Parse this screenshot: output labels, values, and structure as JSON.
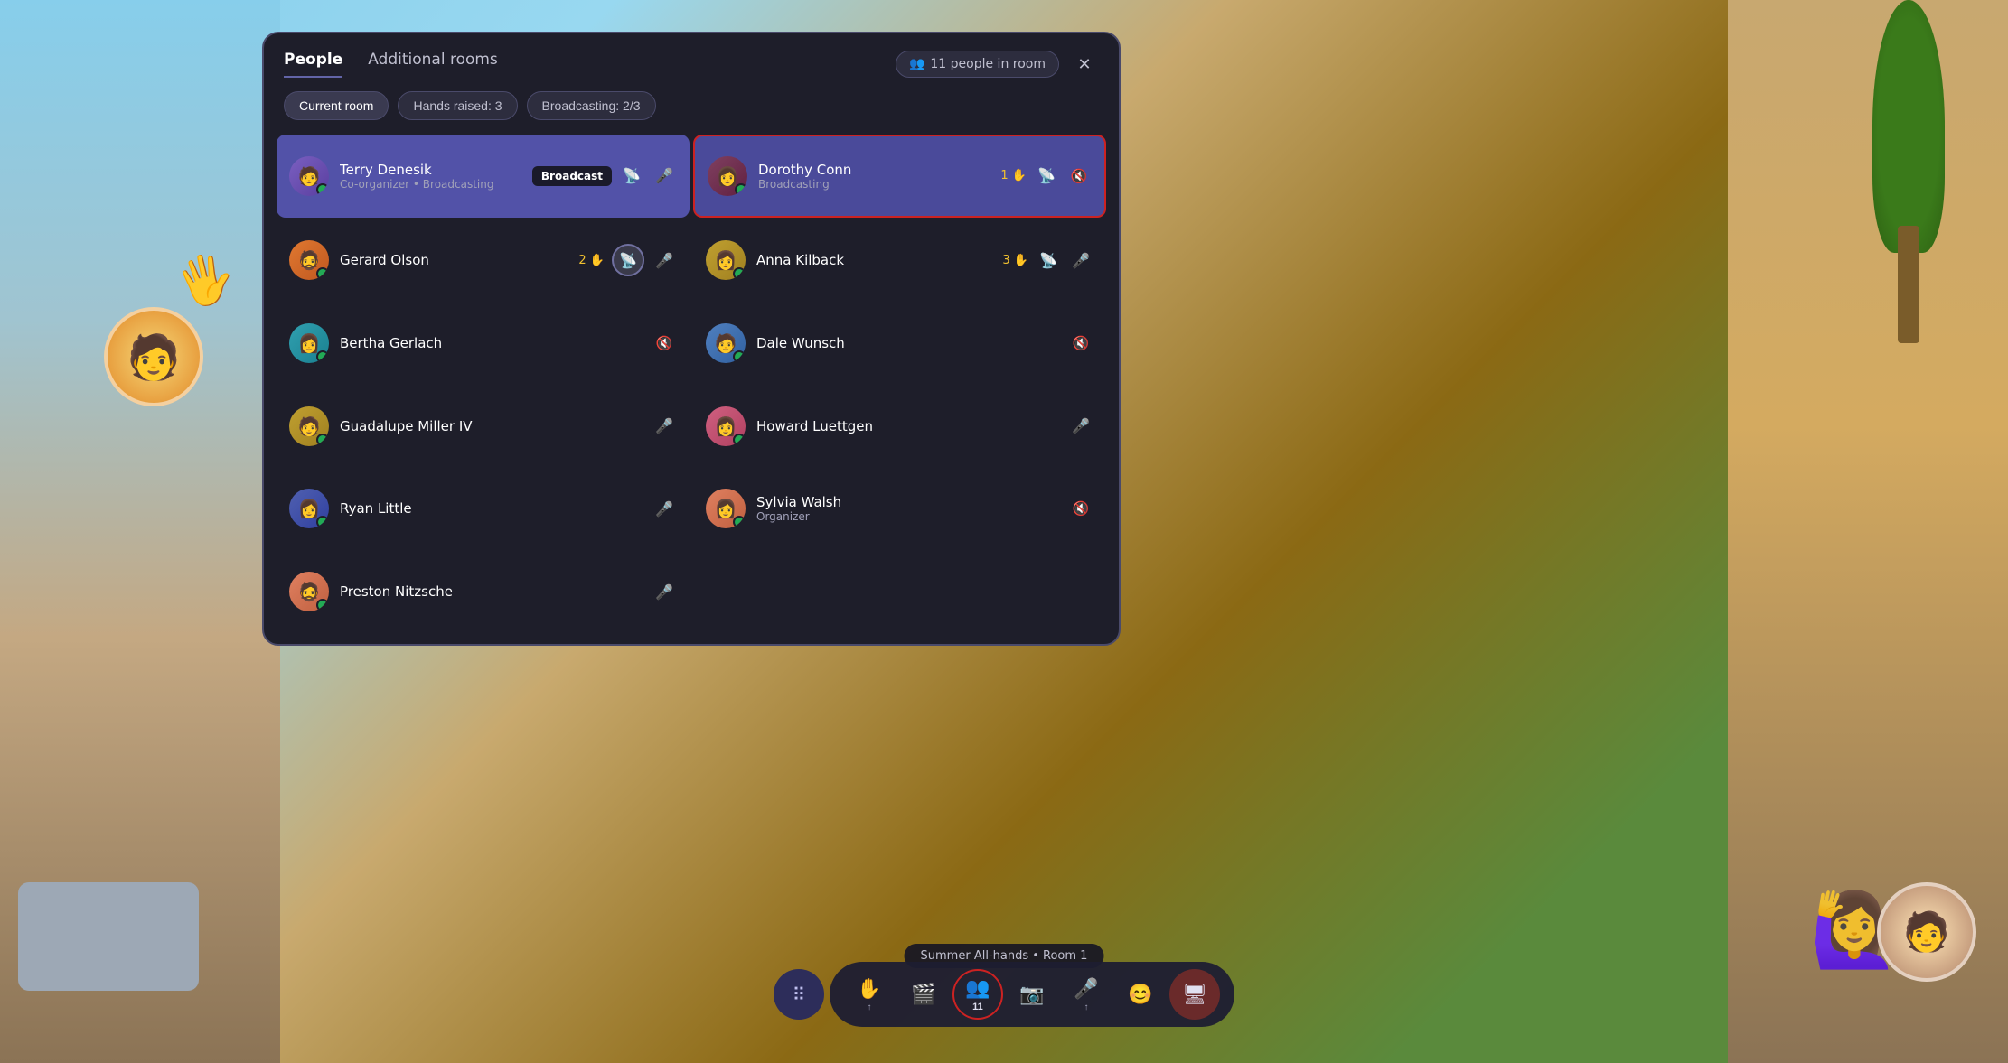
{
  "tabs": {
    "people": "People",
    "additional_rooms": "Additional rooms"
  },
  "header": {
    "people_count": "11 people in room",
    "close_label": "✕"
  },
  "filters": {
    "current_room": "Current room",
    "hands_raised": "Hands raised: 3",
    "broadcasting": "Broadcasting: 2/3"
  },
  "people": [
    {
      "name": "Terry Denesik",
      "role": "Co-organizer • Broadcasting",
      "avatar_color": "av-purple",
      "avatar_emoji": "🧑",
      "broadcast_badge": "Broadcast",
      "has_broadcast_icon": true,
      "mic_muted": false,
      "column": "left",
      "broadcasting": true
    },
    {
      "name": "Dorothy Conn",
      "role": "Broadcasting",
      "avatar_color": "av-maroon",
      "avatar_emoji": "👩",
      "hand_count": "1",
      "has_broadcast_icon": true,
      "mic_muted": true,
      "column": "right",
      "highlighted": true
    },
    {
      "name": "Gerard Olson",
      "role": "",
      "avatar_color": "av-orange",
      "avatar_emoji": "🧔",
      "hand_count": "2",
      "has_active_broadcast": true,
      "mic_muted": false,
      "column": "left"
    },
    {
      "name": "Anna Kilback",
      "role": "",
      "avatar_color": "av-yellow",
      "avatar_emoji": "👩",
      "hand_count": "3",
      "has_broadcast_icon": true,
      "mic_muted": false,
      "column": "right"
    },
    {
      "name": "Bertha Gerlach",
      "role": "",
      "avatar_color": "av-teal",
      "avatar_emoji": "👩",
      "mic_muted": true,
      "column": "left"
    },
    {
      "name": "Dale Wunsch",
      "role": "",
      "avatar_color": "av-blue",
      "avatar_emoji": "🧑",
      "mic_muted": true,
      "column": "right"
    },
    {
      "name": "Guadalupe Miller IV",
      "role": "",
      "avatar_color": "av-yellow",
      "avatar_emoji": "🧑",
      "mic_muted": false,
      "column": "left"
    },
    {
      "name": "Howard Luettgen",
      "role": "",
      "avatar_color": "av-pink",
      "avatar_emoji": "👩",
      "mic_muted": false,
      "column": "right"
    },
    {
      "name": "Ryan Little",
      "role": "",
      "avatar_color": "av-indigo",
      "avatar_emoji": "👩",
      "mic_muted": false,
      "column": "left"
    },
    {
      "name": "Sylvia Walsh",
      "role": "Organizer",
      "avatar_color": "av-coral",
      "avatar_emoji": "👩",
      "mic_muted": true,
      "column": "right"
    },
    {
      "name": "Preston Nitzsche",
      "role": "",
      "avatar_color": "av-coral",
      "avatar_emoji": "🧔",
      "mic_muted": false,
      "column": "left"
    }
  ],
  "toolbar": {
    "apps_icon": "⋮⋮⋮",
    "raise_hand_label": "✋",
    "share_label": "🎬",
    "people_label": "11",
    "camera_label": "📷",
    "mic_label": "🎤",
    "emoji_label": "😊",
    "share_screen_label": "🖥"
  },
  "status_bar": "Summer All-hands • Room 1",
  "icons": {
    "mic_on": "🎤",
    "mic_off": "🔇",
    "broadcast": "📡",
    "hand": "✋",
    "people": "👥"
  }
}
